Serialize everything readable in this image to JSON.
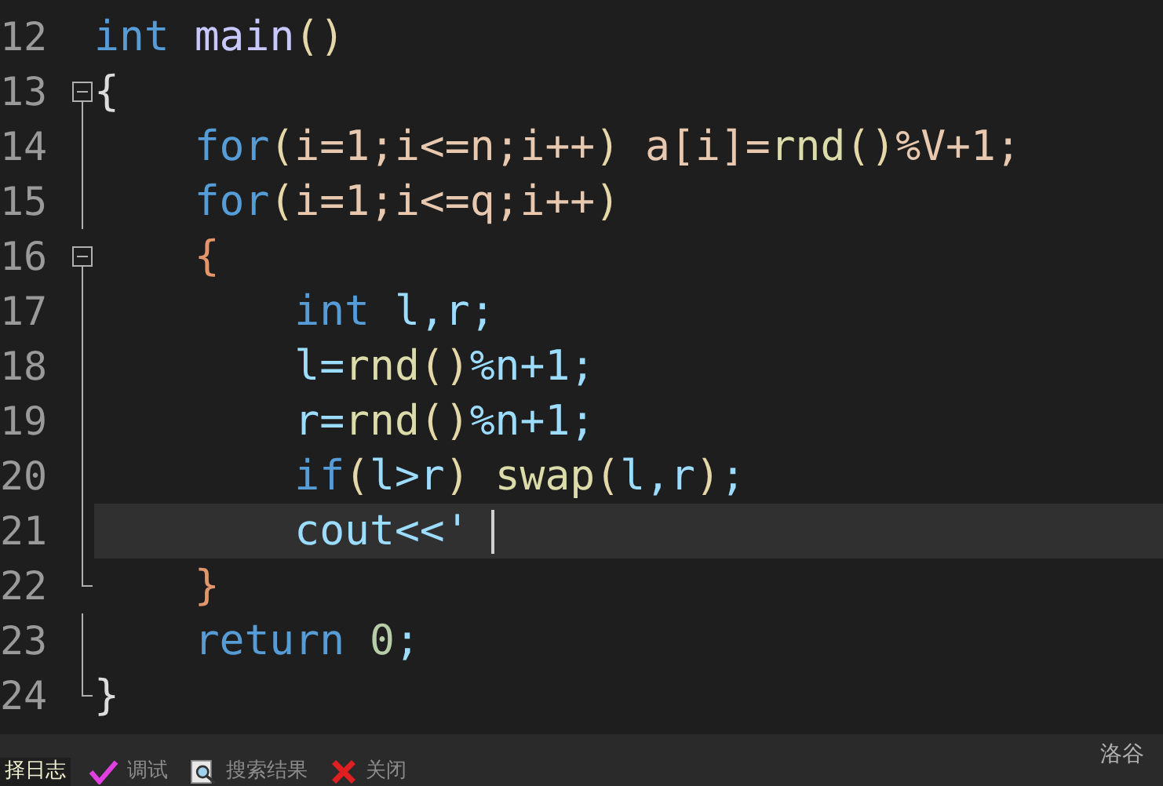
{
  "editor": {
    "lines": [
      {
        "number": "12",
        "kind": "plain",
        "tokens": [
          {
            "kind": "keyword",
            "text": "int"
          },
          {
            "kind": "func",
            "text": " main"
          },
          {
            "kind": "paren",
            "text": "()"
          }
        ]
      },
      {
        "number": "13",
        "kind": "fold_start",
        "tokens": [
          {
            "kind": "plain",
            "text": "{"
          }
        ]
      },
      {
        "number": "14",
        "kind": "fold_body",
        "tokens": [
          {
            "kind": "keyword",
            "text": "    for"
          },
          {
            "kind": "paren",
            "text": "("
          },
          {
            "kind": "var",
            "text": "i=1;i<=n;i++"
          },
          {
            "kind": "paren",
            "text": ")"
          },
          {
            "kind": "var",
            "text": " a[i]="
          },
          {
            "kind": "call",
            "text": "rnd"
          },
          {
            "kind": "paren",
            "text": "()"
          },
          {
            "kind": "var",
            "text": "%V+1;"
          }
        ]
      },
      {
        "number": "15",
        "kind": "fold_body",
        "tokens": [
          {
            "kind": "keyword",
            "text": "    for"
          },
          {
            "kind": "paren",
            "text": "("
          },
          {
            "kind": "var",
            "text": "i=1;i<=q;i++"
          },
          {
            "kind": "paren",
            "text": ")"
          }
        ]
      },
      {
        "number": "16",
        "kind": "fold_start",
        "tokens": [
          {
            "kind": "brace",
            "text": "    {"
          }
        ]
      },
      {
        "number": "17",
        "kind": "fold_body",
        "tokens": [
          {
            "kind": "keyword",
            "text": "        int"
          },
          {
            "kind": "local",
            "text": " l,r;"
          }
        ]
      },
      {
        "number": "18",
        "kind": "fold_body",
        "tokens": [
          {
            "kind": "local",
            "text": "        l="
          },
          {
            "kind": "call",
            "text": "rnd"
          },
          {
            "kind": "paren",
            "text": "()"
          },
          {
            "kind": "local",
            "text": "%n+1;"
          }
        ]
      },
      {
        "number": "19",
        "kind": "fold_body",
        "tokens": [
          {
            "kind": "local",
            "text": "        r="
          },
          {
            "kind": "call",
            "text": "rnd"
          },
          {
            "kind": "paren",
            "text": "()"
          },
          {
            "kind": "local",
            "text": "%n+1;"
          }
        ]
      },
      {
        "number": "20",
        "kind": "fold_body",
        "tokens": [
          {
            "kind": "keyword",
            "text": "        if"
          },
          {
            "kind": "paren",
            "text": "("
          },
          {
            "kind": "local",
            "text": "l>r"
          },
          {
            "kind": "paren",
            "text": ")"
          },
          {
            "kind": "call",
            "text": " swap"
          },
          {
            "kind": "paren",
            "text": "("
          },
          {
            "kind": "local",
            "text": "l,r"
          },
          {
            "kind": "paren",
            "text": ")"
          },
          {
            "kind": "local",
            "text": ";"
          }
        ]
      },
      {
        "number": "21",
        "kind": "fold_body",
        "current": true,
        "tokens": [
          {
            "kind": "local",
            "text": "        cout<<'"
          }
        ]
      },
      {
        "number": "22",
        "kind": "fold_end",
        "tokens": [
          {
            "kind": "brace",
            "text": "    }"
          }
        ]
      },
      {
        "number": "23",
        "kind": "fold_body",
        "tokens": [
          {
            "kind": "keyword",
            "text": "    return"
          },
          {
            "kind": "number",
            "text": " 0"
          },
          {
            "kind": "local",
            "text": ";"
          }
        ]
      },
      {
        "number": "24",
        "kind": "fold_end",
        "tokens": [
          {
            "kind": "plain",
            "text": "}"
          }
        ]
      }
    ]
  },
  "status_bar": {
    "text": "洛谷"
  },
  "bottom_tabs": [
    {
      "label": "择日志",
      "kind": "log",
      "selected": true
    },
    {
      "label": "调试",
      "kind": "debug",
      "selected": false
    },
    {
      "label": "搜索结果",
      "kind": "search",
      "selected": false
    },
    {
      "label": "关闭",
      "kind": "close",
      "selected": false
    }
  ]
}
